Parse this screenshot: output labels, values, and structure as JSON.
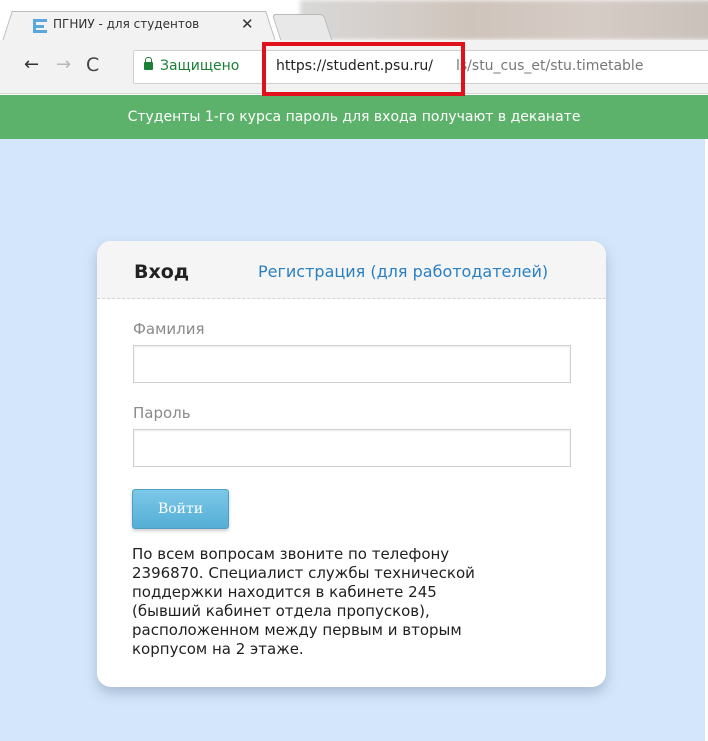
{
  "browser": {
    "tab_title": "ПГНИУ - для студентов",
    "tab_close_glyph": "✕",
    "nav": {
      "back_glyph": "←",
      "forward_glyph": "→",
      "reload_glyph": "C"
    },
    "omnibox": {
      "secure_label": "Защищено",
      "url_host": "https://student.psu.ru/",
      "url_path": "ls/stu_cus_et/stu.timetable"
    }
  },
  "notice": {
    "text": "Студенты 1-го курса пароль для входа получают в деканате"
  },
  "login": {
    "title": "Вход",
    "register_link": "Регистрация (для работодателей)",
    "surname_label": "Фамилия",
    "surname_value": "",
    "password_label": "Пароль",
    "password_value": "",
    "submit_label": "Войти",
    "help_text": "По всем вопросам звоните по телефону\n2396870. Специалист службы технической\nподдержки находится в кабинете 245\n(бывший кабинет отдела пропусков),\nрасположенном между первым и вторым\nкорпусом на 2 этаже."
  },
  "colors": {
    "notice_bg": "#5db26b",
    "page_bg": "#d3e6fb",
    "link": "#2a7fc1",
    "secure": "#1a7f37",
    "highlight": "#e0111d",
    "button": "#54aed5"
  },
  "icons": {
    "tab_favicon": "e-favicon-icon",
    "lock": "lock-icon"
  }
}
